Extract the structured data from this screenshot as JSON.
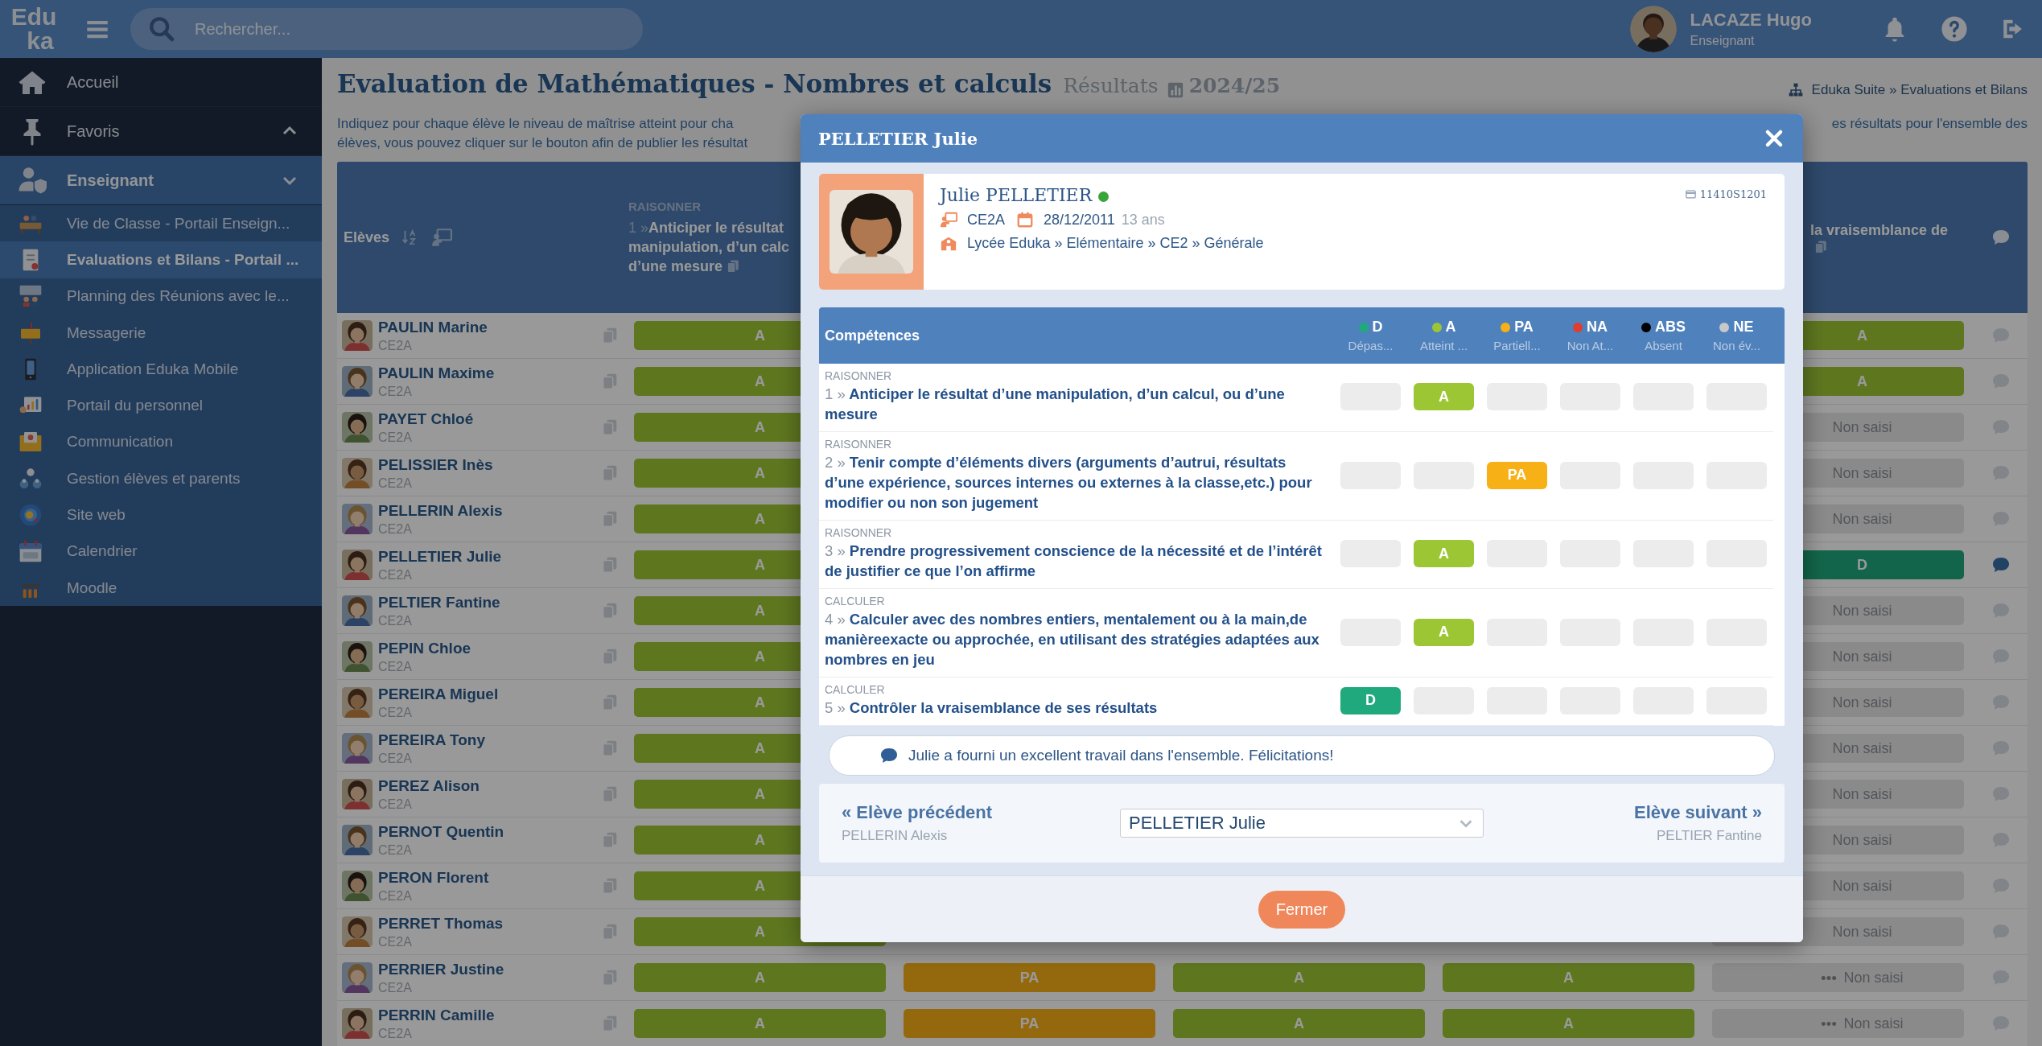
{
  "topbar": {
    "logo": [
      "Edu",
      "ka"
    ],
    "search": {
      "placeholder": "Rechercher..."
    },
    "user": {
      "name": "LACAZE Hugo",
      "role": "Enseignant"
    }
  },
  "sidebar": {
    "items": [
      {
        "label": "Accueil",
        "kind": "link"
      },
      {
        "label": "Favoris",
        "kind": "section",
        "expanded": false
      },
      {
        "label": "Enseignant",
        "kind": "section",
        "expanded": true,
        "children": [
          {
            "label": "Vie de Classe - Portail Enseign...",
            "selected": false
          },
          {
            "label": "Evaluations et Bilans - Portail ...",
            "selected": true
          },
          {
            "label": "Planning des Réunions avec le...",
            "selected": false
          },
          {
            "label": "Messagerie",
            "selected": false
          },
          {
            "label": "Application Eduka Mobile",
            "selected": false
          },
          {
            "label": "Portail du personnel",
            "selected": false
          },
          {
            "label": "Communication",
            "selected": false
          },
          {
            "label": "Gestion élèves et parents",
            "selected": false
          },
          {
            "label": "Site web",
            "selected": false
          },
          {
            "label": "Calendrier",
            "selected": false
          },
          {
            "label": "Moodle",
            "selected": false
          }
        ]
      }
    ]
  },
  "page": {
    "title": "Evaluation de Mathématiques - Nombres et calculs",
    "subtitle": "Résultats",
    "year": "2024/25",
    "breadcrumb": "Eduka Suite » Evaluations et Bilans",
    "description_left": [
      "Indiquez pour chaque élève le niveau de maîtrise atteint pour cha",
      "élèves, vous pouvez cliquer sur le bouton afin de publier les résultat"
    ],
    "description_right": "es résultats pour l'ensemble des"
  },
  "table": {
    "students_header": "Elèves",
    "grade_columns": {
      "column_1": {
        "domain": "RAISONNER",
        "number": "1 »",
        "lines": [
          "Anticiper le résultat",
          "manipulation, d’un calc",
          "d’une mesure"
        ]
      },
      "column_5": {
        "lines": [
          "la vraisemblance de"
        ]
      }
    },
    "rows": [
      {
        "name": "PAULIN Marine",
        "class": "CE2A",
        "grade_1": "A",
        "grade_5": "A",
        "comment": false
      },
      {
        "name": "PAULIN Maxime",
        "class": "CE2A",
        "grade_1": "A",
        "grade_5": "A",
        "comment": false
      },
      {
        "name": "PAYET Chloé",
        "class": "CE2A",
        "grade_1": "A",
        "grade_5": "Non saisi",
        "comment": false
      },
      {
        "name": "PELISSIER Inès",
        "class": "CE2A",
        "grade_1": "A",
        "grade_5": "Non saisi",
        "comment": false
      },
      {
        "name": "PELLERIN Alexis",
        "class": "CE2A",
        "grade_1": "A",
        "grade_5": "Non saisi",
        "comment": false
      },
      {
        "name": "PELLETIER Julie",
        "class": "CE2A",
        "grade_1": "A",
        "grade_5": "D",
        "comment": true
      },
      {
        "name": "PELTIER Fantine",
        "class": "CE2A",
        "grade_1": "A",
        "grade_5": "Non saisi",
        "comment": false
      },
      {
        "name": "PEPIN Chloe",
        "class": "CE2A",
        "grade_1": "A",
        "grade_5": "Non saisi",
        "comment": false
      },
      {
        "name": "PEREIRA Miguel",
        "class": "CE2A",
        "grade_1": "A",
        "grade_5": "Non saisi",
        "comment": false
      },
      {
        "name": "PEREIRA Tony",
        "class": "CE2A",
        "grade_1": "A",
        "grade_5": "Non saisi",
        "comment": false
      },
      {
        "name": "PEREZ Alison",
        "class": "CE2A",
        "grade_1": "A",
        "grade_5": "Non saisi",
        "comment": false
      },
      {
        "name": "PERNOT Quentin",
        "class": "CE2A",
        "grade_1": "A",
        "grade_5": "Non saisi",
        "comment": false
      },
      {
        "name": "PERON Florent",
        "class": "CE2A",
        "grade_1": "A",
        "grade_5": "Non saisi",
        "comment": false
      },
      {
        "name": "PERRET Thomas",
        "class": "CE2A",
        "grade_1": "A",
        "grade_5": "Non saisi",
        "comment": false
      },
      {
        "name": "PERRIER Justine",
        "class": "CE2A",
        "grade_1": "A",
        "grade_2": "PA",
        "grade_3": "A",
        "grade_4": "A",
        "grade_5": "Non saisi",
        "comment": false
      },
      {
        "name": "PERRIN Camille",
        "class": "CE2A",
        "grade_1": "A",
        "grade_2": "PA",
        "grade_3": "A",
        "grade_4": "A",
        "grade_5": "Non saisi",
        "comment": false
      }
    ]
  },
  "modal": {
    "title": "PELLETIER Julie",
    "student": {
      "name": "Julie PELLETIER",
      "online": true,
      "class": "CE2A",
      "birthdate": "28/12/2011",
      "age": "13 ans",
      "school": "Lycée Eduka » Elémentaire » CE2 » Générale",
      "id": "11410S1201"
    },
    "competences": {
      "heading": "Compétences",
      "levels": [
        {
          "code": "D",
          "label": "Dépas...",
          "color": "#1fa97c"
        },
        {
          "code": "A",
          "label": "Atteint ...",
          "color": "#9dc635"
        },
        {
          "code": "PA",
          "label": "Partiell...",
          "color": "#f7b016"
        },
        {
          "code": "NA",
          "label": "Non At...",
          "color": "#e03c31"
        },
        {
          "code": "ABS",
          "label": "Absent",
          "color": "#000000"
        },
        {
          "code": "NE",
          "label": "Non év...",
          "color": "#c8c8c8"
        }
      ],
      "rows": [
        {
          "domain": "RAISONNER",
          "number": "1 »",
          "text": "Anticiper le résultat d’une manipulation, d’un calcul, ou d’une mesure",
          "grade": "A"
        },
        {
          "domain": "RAISONNER",
          "number": "2 »",
          "text": "Tenir compte d’éléments divers (arguments d’autrui, résultats d’une expérience, sources internes ou externes à la classe,etc.) pour modifier ou non son jugement",
          "grade": "PA"
        },
        {
          "domain": "RAISONNER",
          "number": "3 »",
          "text": "Prendre progressivement conscience de la nécessité et de l’intérêt de justifier ce que l’on affirme",
          "grade": "A"
        },
        {
          "domain": "CALCULER",
          "number": "4 »",
          "text": "Calculer avec des nombres entiers, mentalement ou à la main,de manièreexacte ou approchée, en utilisant des stratégies adaptées aux nombres en jeu",
          "grade": "A"
        },
        {
          "domain": "CALCULER",
          "number": "5 »",
          "text": "Contrôler la vraisemblance de ses résultats",
          "grade": "D"
        }
      ]
    },
    "comment": "Julie a fourni un excellent travail dans l'ensemble. Félicitations!",
    "navigation": {
      "previous": {
        "label": "« Elève précédent",
        "name": "PELLERIN Alexis"
      },
      "select": "PELLETIER Julie",
      "next": {
        "label": "Elève suivant »",
        "name": "PELTIER Fantine"
      }
    },
    "close_button": "Fermer"
  }
}
